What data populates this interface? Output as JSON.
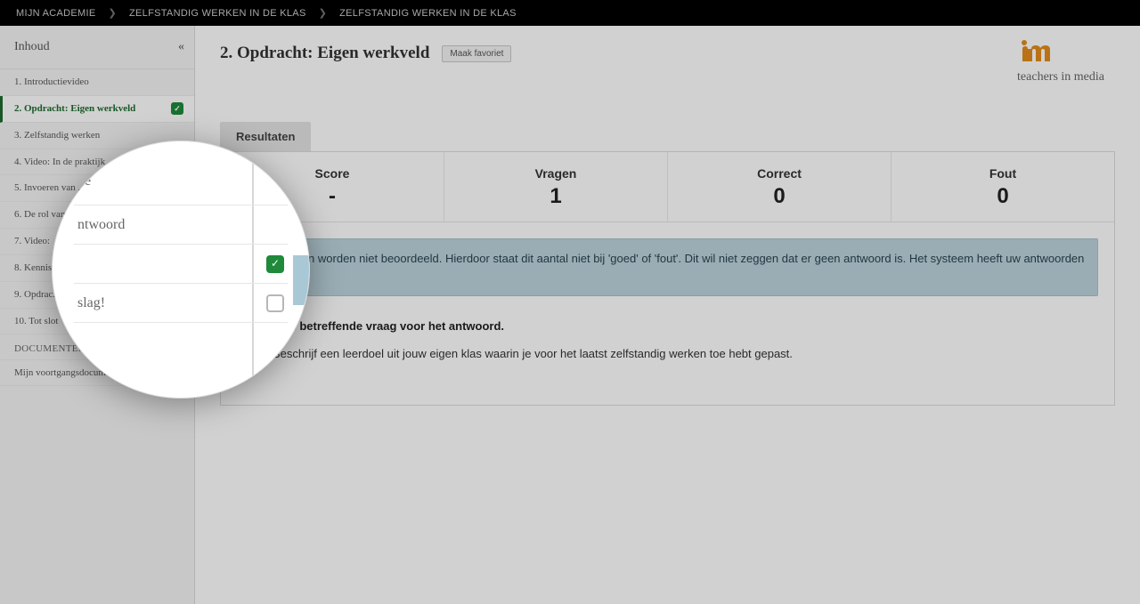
{
  "breadcrumbs": [
    "MIJN ACADEMIE",
    "ZELFSTANDIG WERKEN IN DE KLAS",
    "ZELFSTANDIG WERKEN IN DE KLAS"
  ],
  "sidebar": {
    "title": "Inhoud",
    "items": [
      {
        "label": "1. Introductievideo"
      },
      {
        "label": "2. Opdracht: Eigen werkveld",
        "active": true,
        "checked": true
      },
      {
        "label": "3. Zelfstandig werken"
      },
      {
        "label": "4. Video: In de praktijk"
      },
      {
        "label": "5. Invoeren van ... de stappen"
      },
      {
        "label": "6. De rol van ... leerlingen"
      },
      {
        "label": "7. Video:"
      },
      {
        "label": "8. Kennis..."
      },
      {
        "label": "9. Opdrac..."
      },
      {
        "label": "10. Tot slot"
      }
    ],
    "section_label": "DOCUMENTEN",
    "doc_label": "Mijn voortgangsdocum..."
  },
  "main": {
    "title": "2. Opdracht: Eigen werkveld",
    "favorite_label": "Maak favoriet",
    "brand_text": "teachers in media",
    "tab_label": "Resultaten",
    "stats": {
      "score": {
        "label": "Score",
        "value": "-"
      },
      "vragen": {
        "label": "Vragen",
        "value": "1"
      },
      "correct": {
        "label": "Correct",
        "value": "0"
      },
      "fout": {
        "label": "Fout",
        "value": "0"
      }
    },
    "notice": "open vragen worden niet beoordeeld. Hierdoor staat dit aantal niet bij 'goed' of 'fout'. Dit wil niet zeggen dat er geen antwoord is. Het systeem heeft uw antwoorden ontvangen.",
    "question_header": "p de betreffende vraag voor het antwoord.",
    "question_text": "Beschrijf een leerdoel uit jouw eigen klas waarin je voor het laatst zelfstandig werken toe hebt gepast."
  },
  "lens": {
    "row1": "de",
    "row2": "ntwoord",
    "row4": "slag!"
  }
}
